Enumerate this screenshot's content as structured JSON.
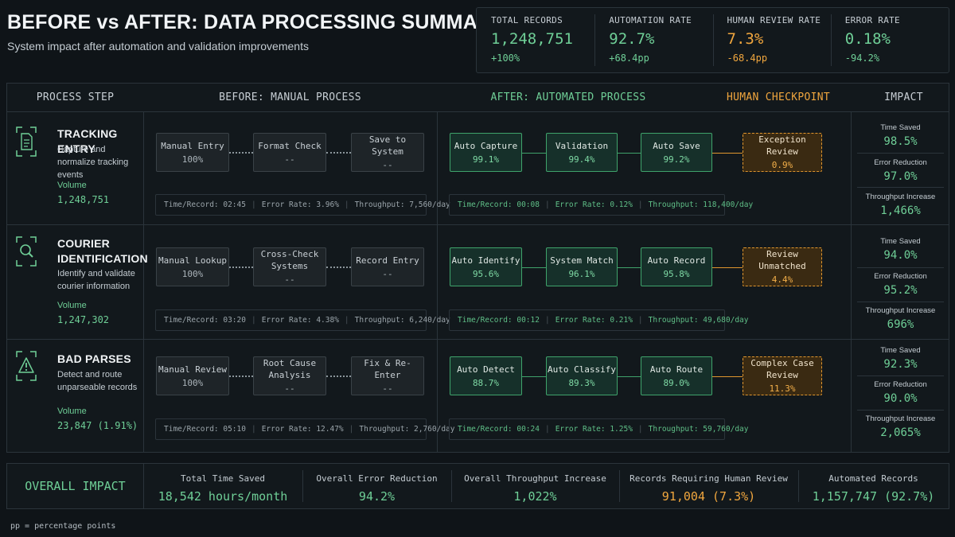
{
  "header": {
    "title": "BEFORE vs AFTER: DATA PROCESSING SUMMARY",
    "subtitle": "System impact after automation and validation improvements"
  },
  "kpis": [
    {
      "label": "TOTAL RECORDS",
      "value": "1,248,751",
      "delta": "+100%"
    },
    {
      "label": "AUTOMATION RATE",
      "value": "92.7%",
      "delta": "+68.4pp"
    },
    {
      "label": "HUMAN REVIEW RATE",
      "value": "7.3%",
      "delta": "-68.4pp"
    },
    {
      "label": "ERROR RATE",
      "value": "0.18%",
      "delta": "-94.2%"
    }
  ],
  "columns": {
    "step": "PROCESS STEP",
    "before": "BEFORE: MANUAL PROCESS",
    "after": "AFTER: AUTOMATED PROCESS",
    "human": "HUMAN CHECKPOINT",
    "impact": "IMPACT"
  },
  "rows": [
    {
      "name": "TRACKING ENTRY",
      "desc": "Capture and normalize tracking events",
      "volume_label": "Volume",
      "volume": "1,248,751",
      "icon": "document-icon",
      "manual": [
        {
          "name": "Manual Entry",
          "value": "100%"
        },
        {
          "name": "Format Check",
          "value": "--"
        },
        {
          "name": "Save to System",
          "value": "--"
        }
      ],
      "manual_metrics": [
        "Time/Record: 02:45",
        "Error Rate: 3.96%",
        "Throughput: 7,560/day"
      ],
      "auto": [
        {
          "name": "Auto Capture",
          "value": "99.1%"
        },
        {
          "name": "Validation",
          "value": "99.4%"
        },
        {
          "name": "Auto Save",
          "value": "99.2%"
        }
      ],
      "human": {
        "name": "Exception Review",
        "value": "0.9%"
      },
      "auto_metrics": [
        "Time/Record: 00:08",
        "Error Rate: 0.12%",
        "Throughput: 118,400/day"
      ],
      "impact": [
        {
          "label": "Time Saved",
          "value": "98.5%"
        },
        {
          "label": "Error Reduction",
          "value": "97.0%"
        },
        {
          "label": "Throughput Increase",
          "value": "1,466%"
        }
      ]
    },
    {
      "name": "COURIER IDENTIFICATION",
      "desc": "Identify and validate courier information",
      "volume_label": "Volume",
      "volume": "1,247,302",
      "icon": "magnifier-icon",
      "manual": [
        {
          "name": "Manual Lookup",
          "value": "100%"
        },
        {
          "name": "Cross-Check Systems",
          "value": "--"
        },
        {
          "name": "Record Entry",
          "value": "--"
        }
      ],
      "manual_metrics": [
        "Time/Record: 03:20",
        "Error Rate: 4.38%",
        "Throughput: 6,240/day"
      ],
      "auto": [
        {
          "name": "Auto Identify",
          "value": "95.6%"
        },
        {
          "name": "System Match",
          "value": "96.1%"
        },
        {
          "name": "Auto Record",
          "value": "95.8%"
        }
      ],
      "human": {
        "name": "Review Unmatched",
        "value": "4.4%"
      },
      "auto_metrics": [
        "Time/Record: 00:12",
        "Error Rate: 0.21%",
        "Throughput: 49,680/day"
      ],
      "impact": [
        {
          "label": "Time Saved",
          "value": "94.0%"
        },
        {
          "label": "Error Reduction",
          "value": "95.2%"
        },
        {
          "label": "Throughput Increase",
          "value": "696%"
        }
      ]
    },
    {
      "name": "BAD PARSES",
      "desc": "Detect and route unparseable records",
      "volume_label": "Volume",
      "volume": "23,847 (1.91%)",
      "icon": "warning-icon",
      "manual": [
        {
          "name": "Manual Review",
          "value": "100%"
        },
        {
          "name": "Root Cause Analysis",
          "value": "--"
        },
        {
          "name": "Fix & Re-Enter",
          "value": "--"
        }
      ],
      "manual_metrics": [
        "Time/Record: 05:10",
        "Error Rate: 12.47%",
        "Throughput: 2,760/day"
      ],
      "auto": [
        {
          "name": "Auto Detect",
          "value": "88.7%"
        },
        {
          "name": "Auto Classify",
          "value": "89.3%"
        },
        {
          "name": "Auto Route",
          "value": "89.0%"
        }
      ],
      "human": {
        "name": "Complex Case Review",
        "value": "11.3%"
      },
      "auto_metrics": [
        "Time/Record: 00:24",
        "Error Rate: 1.25%",
        "Throughput: 59,760/day"
      ],
      "impact": [
        {
          "label": "Time Saved",
          "value": "92.3%"
        },
        {
          "label": "Error Reduction",
          "value": "90.0%"
        },
        {
          "label": "Throughput Increase",
          "value": "2,065%"
        }
      ]
    }
  ],
  "footer": {
    "title": "OVERALL IMPACT",
    "stats": [
      {
        "label": "Total Time Saved",
        "value": "18,542 hours/month"
      },
      {
        "label": "Overall Error Reduction",
        "value": "94.2%"
      },
      {
        "label": "Overall Throughput Increase",
        "value": "1,022%"
      },
      {
        "label": "Records Requiring Human Review",
        "value": "91,004 (7.3%)"
      },
      {
        "label": "Automated Records",
        "value": "1,157,747 (92.7%)"
      }
    ]
  },
  "note": "pp = percentage points",
  "colors": {
    "green": "#6fcf97",
    "orange": "#f0a63e",
    "background": "#0f1418"
  }
}
